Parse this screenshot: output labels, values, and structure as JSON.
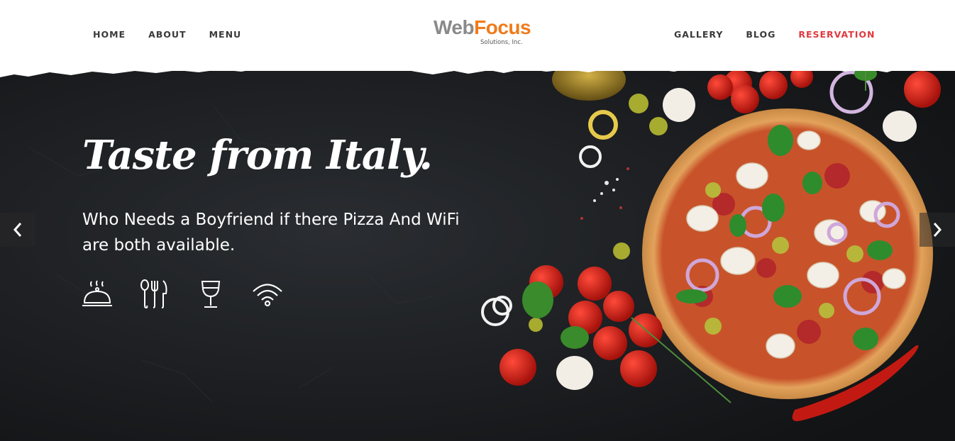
{
  "nav": {
    "left": [
      {
        "label": "HOME"
      },
      {
        "label": "ABOUT"
      },
      {
        "label": "MENU"
      }
    ],
    "right": [
      {
        "label": "GALLERY"
      },
      {
        "label": "BLOG"
      },
      {
        "label": "RESERVATION"
      }
    ],
    "active_color": "#e0393e"
  },
  "logo": {
    "part1": "Web",
    "part2": "Focus",
    "sub": "Solutions, Inc.",
    "color1": "#8a8a8a",
    "color2": "#f07b1b"
  },
  "hero": {
    "title": "Taste from Italy.",
    "subtitle": "Who Needs a Boyfriend if there Pizza And WiFi are both available.",
    "icons": [
      "cloche-icon",
      "cutlery-icon",
      "wine-glass-icon",
      "wifi-icon"
    ],
    "prev_icon": "chevron-left-icon",
    "next_icon": "chevron-right-icon"
  }
}
